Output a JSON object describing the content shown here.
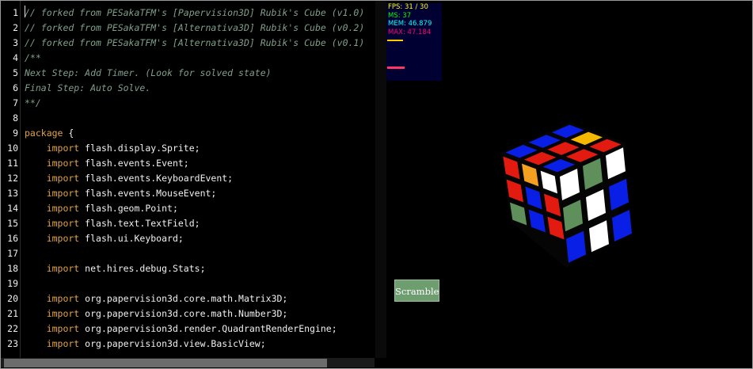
{
  "editor": {
    "lines": [
      {
        "n": "1",
        "parts": [
          {
            "t": "// forked from PESakaTFM's [Papervision3D] Rubik's Cube (v1.0)",
            "c": "comment"
          }
        ]
      },
      {
        "n": "2",
        "parts": [
          {
            "t": "// forked from PESakaTFM's [Alternativa3D] Rubik's Cube (v0.2)",
            "c": "comment"
          }
        ]
      },
      {
        "n": "3",
        "parts": [
          {
            "t": "// forked from PESakaTFM's [Alternativa3D] Rubik's Cube (v0.1)",
            "c": "comment"
          }
        ]
      },
      {
        "n": "4",
        "parts": [
          {
            "t": "/**",
            "c": "comment"
          }
        ]
      },
      {
        "n": "5",
        "parts": [
          {
            "t": "Next Step: Add Timer. (Look for solved state)",
            "c": "comment"
          }
        ]
      },
      {
        "n": "6",
        "parts": [
          {
            "t": "Final Step: Auto Solve.",
            "c": "comment"
          }
        ]
      },
      {
        "n": "7",
        "parts": [
          {
            "t": "**/",
            "c": "comment"
          }
        ]
      },
      {
        "n": "8",
        "parts": []
      },
      {
        "n": "9",
        "parts": [
          {
            "t": "package",
            "c": "kw"
          },
          {
            "t": " {",
            "c": "plain"
          }
        ]
      },
      {
        "n": "10",
        "parts": [
          {
            "t": "    import",
            "c": "kw"
          },
          {
            "t": " flash.display.Sprite;",
            "c": "plain"
          }
        ]
      },
      {
        "n": "11",
        "parts": [
          {
            "t": "    import",
            "c": "kw"
          },
          {
            "t": " flash.events.Event;",
            "c": "plain"
          }
        ]
      },
      {
        "n": "12",
        "parts": [
          {
            "t": "    import",
            "c": "kw"
          },
          {
            "t": " flash.events.KeyboardEvent;",
            "c": "plain"
          }
        ]
      },
      {
        "n": "13",
        "parts": [
          {
            "t": "    import",
            "c": "kw"
          },
          {
            "t": " flash.events.MouseEvent;",
            "c": "plain"
          }
        ]
      },
      {
        "n": "14",
        "parts": [
          {
            "t": "    import",
            "c": "kw"
          },
          {
            "t": " flash.geom.Point;",
            "c": "plain"
          }
        ]
      },
      {
        "n": "15",
        "parts": [
          {
            "t": "    import",
            "c": "kw"
          },
          {
            "t": " flash.text.TextField;",
            "c": "plain"
          }
        ]
      },
      {
        "n": "16",
        "parts": [
          {
            "t": "    import",
            "c": "kw"
          },
          {
            "t": " flash.ui.Keyboard;",
            "c": "plain"
          }
        ]
      },
      {
        "n": "17",
        "parts": []
      },
      {
        "n": "18",
        "parts": [
          {
            "t": "    import",
            "c": "kw"
          },
          {
            "t": " net.hires.debug.Stats;",
            "c": "plain"
          }
        ]
      },
      {
        "n": "19",
        "parts": []
      },
      {
        "n": "20",
        "parts": [
          {
            "t": "    import",
            "c": "kw"
          },
          {
            "t": " org.papervision3d.core.math.Matrix3D;",
            "c": "plain"
          }
        ]
      },
      {
        "n": "21",
        "parts": [
          {
            "t": "    import",
            "c": "kw"
          },
          {
            "t": " org.papervision3d.core.math.Number3D;",
            "c": "plain"
          }
        ]
      },
      {
        "n": "22",
        "parts": [
          {
            "t": "    import",
            "c": "kw"
          },
          {
            "t": " org.papervision3d.render.QuadrantRenderEngine;",
            "c": "plain"
          }
        ]
      },
      {
        "n": "23",
        "parts": [
          {
            "t": "    import",
            "c": "kw"
          },
          {
            "t": " org.papervision3d.view.BasicView;",
            "c": "plain"
          }
        ]
      }
    ]
  },
  "stats": {
    "fps": "FPS: 31 / 30",
    "ms": "MS: 37",
    "mem": "MEM: 46.879",
    "max": "MAX: 47.184"
  },
  "scramble_label": "Scramble",
  "colors": {
    "comment": "#7f9f8a",
    "keyword": "#e2a344",
    "scramble_bg": "#6e9d70",
    "stats_bg": "#000033"
  },
  "cube_faces": {
    "top": [
      "blue",
      "blue",
      "blue",
      "red",
      "red",
      "yellow",
      "blue",
      "red",
      "red"
    ],
    "front": [
      "red",
      "orange",
      "white",
      "red",
      "blue",
      "red",
      "green",
      "blue",
      "red"
    ],
    "right": [
      "white",
      "green",
      "white",
      "green",
      "white",
      "blue",
      "blue",
      "white",
      "blue"
    ]
  }
}
